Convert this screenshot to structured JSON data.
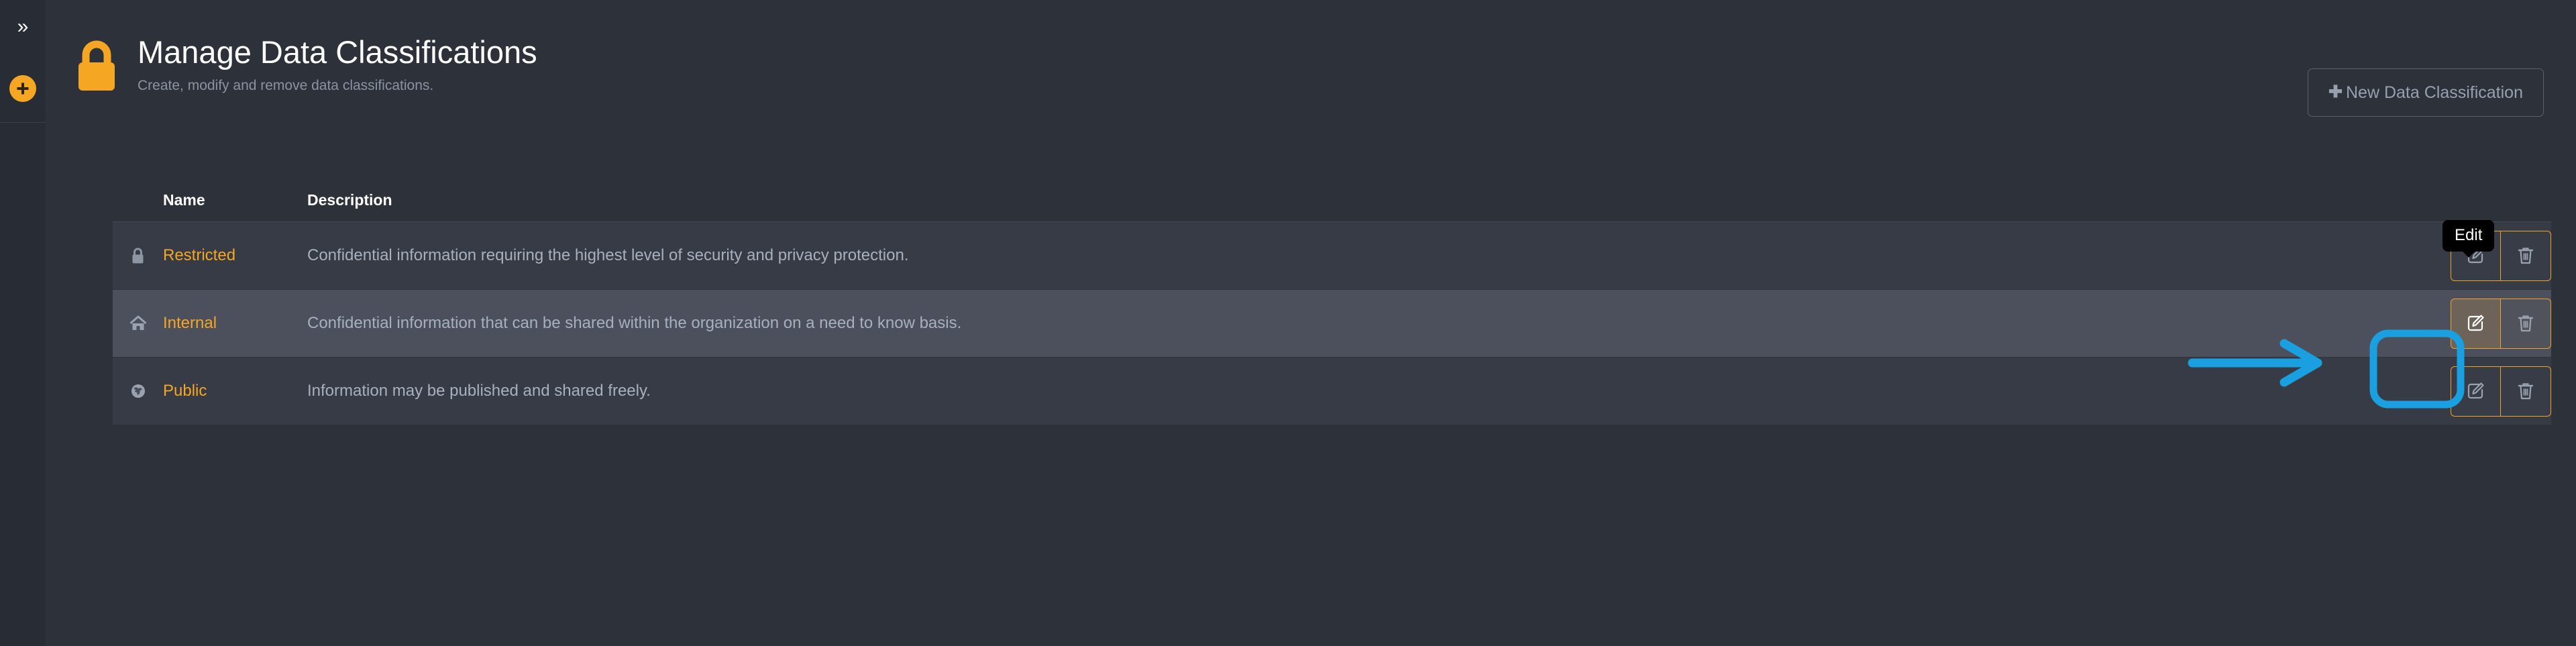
{
  "sidebar": {
    "toggle_icon": "chevron-double-right-icon",
    "toggle_label": "»",
    "add_icon": "plus-circle-icon"
  },
  "header": {
    "icon": "lock-icon",
    "title": "Manage Data Classifications",
    "subtitle": "Create, modify and remove data classifications.",
    "new_button": {
      "icon": "plus-icon",
      "plus_glyph": "✚",
      "label": "New Data Classification"
    }
  },
  "table": {
    "columns": {
      "name": "Name",
      "description": "Description"
    },
    "rows": [
      {
        "icon": "lock-icon",
        "name": "Restricted",
        "description": "Confidential information requiring the highest level of security and privacy protection.",
        "edit_label": "Edit",
        "delete_label": "Delete",
        "hovered": false,
        "edit_active": false
      },
      {
        "icon": "home-icon",
        "name": "Internal",
        "description": "Confidential information that can be shared within the organization on a need to know basis.",
        "edit_label": "Edit",
        "delete_label": "Delete",
        "hovered": true,
        "edit_active": true
      },
      {
        "icon": "globe-icon",
        "name": "Public",
        "description": "Information may be published and shared freely.",
        "edit_label": "Edit",
        "delete_label": "Delete",
        "hovered": false,
        "edit_active": false
      }
    ]
  },
  "tooltip": {
    "text": "Edit"
  },
  "annotation": {
    "type": "arrow-and-highlight",
    "color": "#1a9fe0",
    "target": "edit-button-row-internal"
  },
  "colors": {
    "accent_orange": "#f5a623",
    "background": "#2d313a",
    "sidebar": "#282c34",
    "row": "#373b45",
    "row_hover": "#4b505c",
    "text_primary": "#ffffff",
    "text_muted": "#a8b0be",
    "annotation_blue": "#1a9fe0"
  }
}
